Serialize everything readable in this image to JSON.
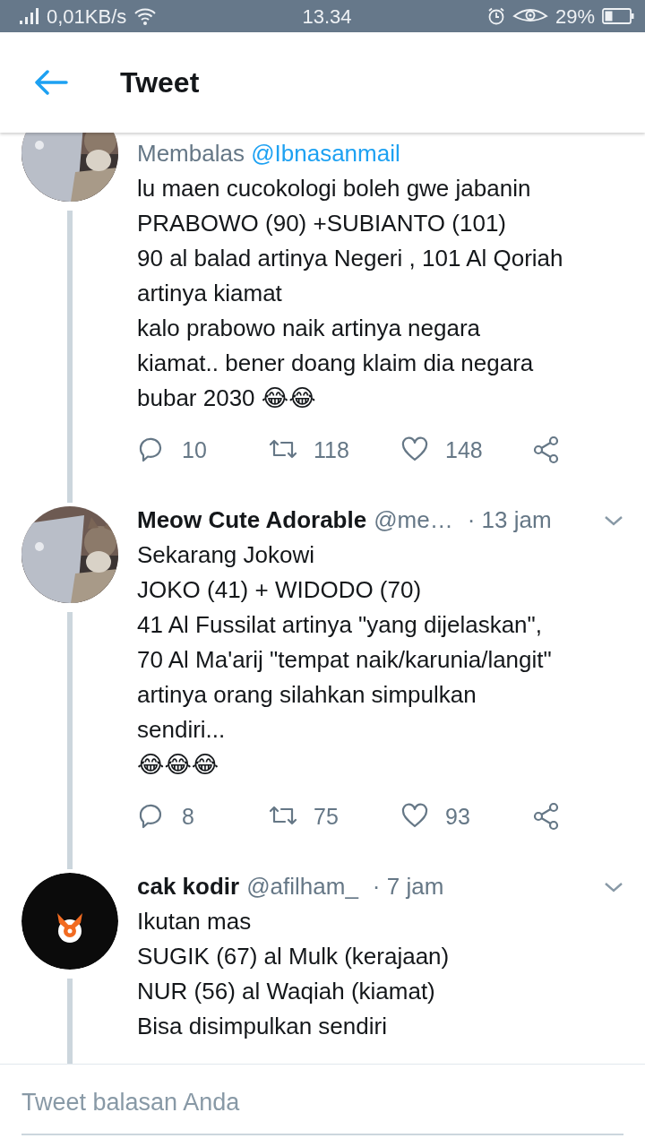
{
  "status_bar": {
    "speed": "0,01KB/s",
    "time": "13.34",
    "battery": "29%"
  },
  "header": {
    "title": "Tweet"
  },
  "tweets": [
    {
      "replying_to": {
        "label": "Membalas",
        "handle": "@Ibnasanmail"
      },
      "body": "lu maen cucokologi boleh gwe jabanin\nPRABOWO (90) +SUBIANTO (101)\n90 al balad artinya Negeri , 101 Al Qoriah\nartinya kiamat\nkalo prabowo naik artinya negara\nkiamat.. bener doang klaim dia negara\nbubar 2030 😂😂",
      "stats": {
        "replies": "10",
        "retweets": "118",
        "likes": "148"
      }
    },
    {
      "name": "Meow Cute Adorable",
      "handle": "@me…",
      "time": "· 13 jam",
      "body": "Sekarang Jokowi\nJOKO (41) + WIDODO (70)\n41 Al Fussilat artinya \"yang dijelaskan\",\n70 Al Ma'arij \"tempat naik/karunia/langit\"\nartinya orang silahkan simpulkan\nsendiri...\n😂😂😂",
      "stats": {
        "replies": "8",
        "retweets": "75",
        "likes": "93"
      }
    },
    {
      "avatar": {
        "kind": "logo"
      },
      "name": "cak kodir",
      "handle": "@afilham_",
      "time": "· 7 jam",
      "body": "Ikutan mas\nSUGIK (67) al Mulk (kerajaan)\nNUR (56) al Waqiah (kiamat)\nBisa disimpulkan sendiri"
    }
  ],
  "reply_box": {
    "placeholder": "Tweet balasan Anda"
  }
}
